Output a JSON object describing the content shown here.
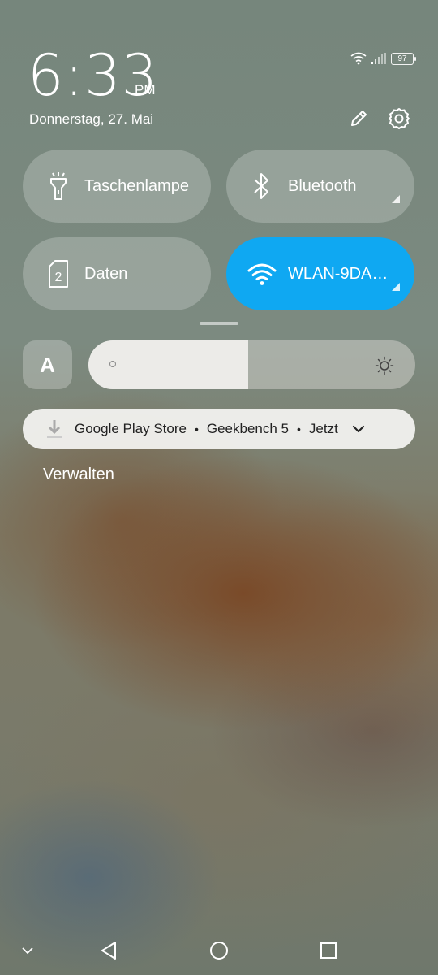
{
  "status": {
    "time": "6:33",
    "ampm": "PM",
    "date": "Donnerstag, 27. Mai",
    "battery": "97",
    "icons": [
      "wifi-icon",
      "signal-icon",
      "battery-icon"
    ]
  },
  "header_actions": [
    "edit-pencil-icon",
    "settings-gear-icon"
  ],
  "tiles": [
    {
      "label": "Taschenlampe",
      "icon": "flashlight-icon",
      "active": false
    },
    {
      "label": "Bluetooth",
      "icon": "bluetooth-icon",
      "active": false
    },
    {
      "label": "Daten",
      "icon": "sim-2-icon",
      "active": false
    },
    {
      "label": "WLAN-9DA…",
      "icon": "wifi-icon",
      "active": true
    }
  ],
  "brightness": {
    "auto_label": "A",
    "level": 0.49
  },
  "notification": {
    "app": "Google Play Store",
    "title": "Geekbench 5",
    "time": "Jetzt",
    "icon": "download-icon"
  },
  "manage_label": "Verwalten",
  "colors": {
    "active_tile": "#0fa8f2"
  },
  "navbar": [
    "collapse-chevron-icon",
    "back-icon",
    "home-icon",
    "recents-icon"
  ]
}
